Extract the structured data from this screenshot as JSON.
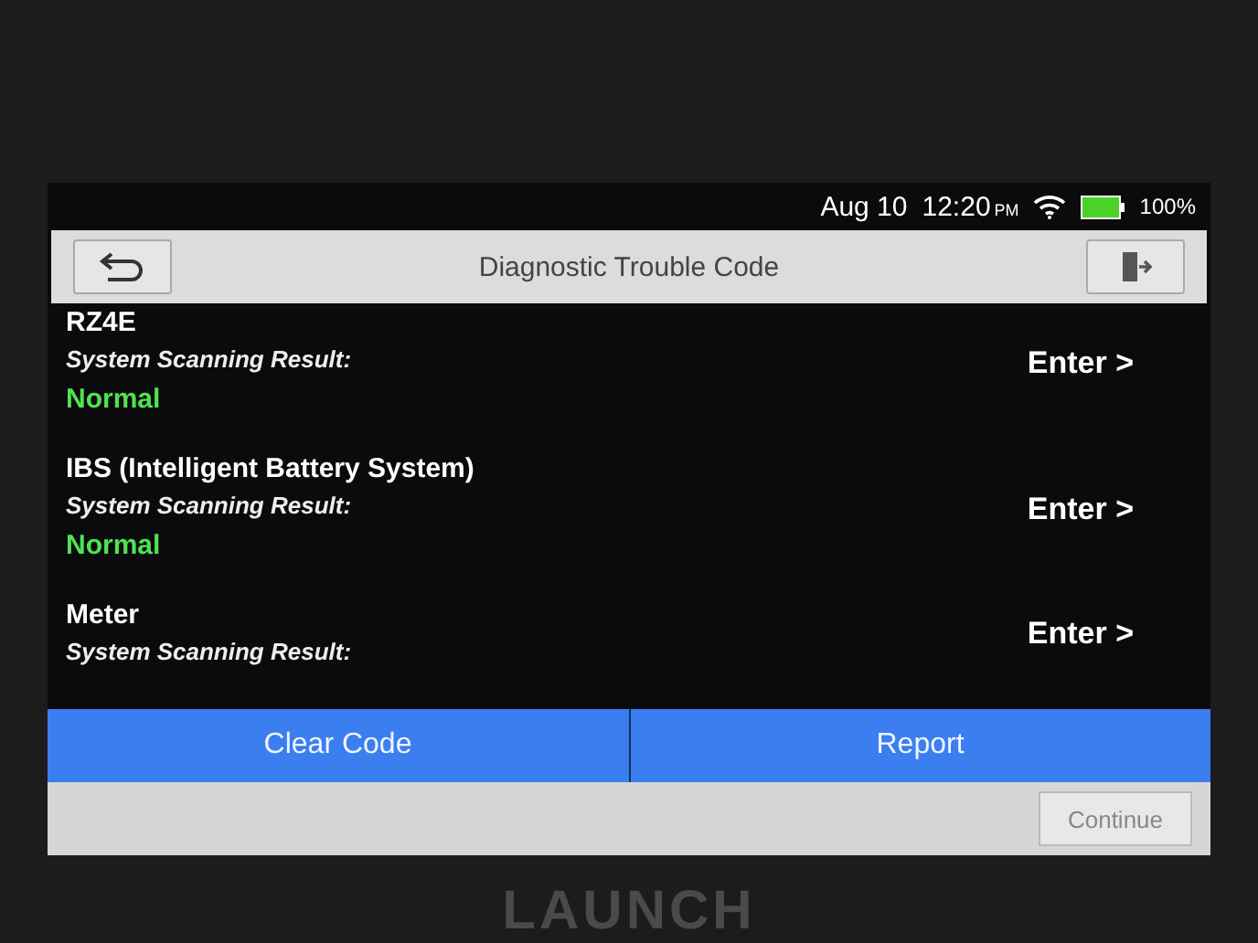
{
  "status_bar": {
    "date": "Aug 10",
    "time": "12:20",
    "meridiem": "PM",
    "battery": "100%"
  },
  "title_bar": {
    "title": "Diagnostic Trouble Code"
  },
  "systems": [
    {
      "name": "RZ4E",
      "result_label": "System Scanning Result:",
      "result": "Normal",
      "action": "Enter >"
    },
    {
      "name": "IBS (Intelligent Battery System)",
      "result_label": "System Scanning Result:",
      "result": "Normal",
      "action": "Enter >"
    },
    {
      "name": "Meter",
      "result_label": "System Scanning Result:",
      "action": "Enter >"
    }
  ],
  "actions": [
    "Clear Code",
    "Report"
  ],
  "footer": {
    "button": {
      "label": "Continue",
      "disabled": true
    }
  },
  "device": {
    "brand": "LAUNCH"
  }
}
